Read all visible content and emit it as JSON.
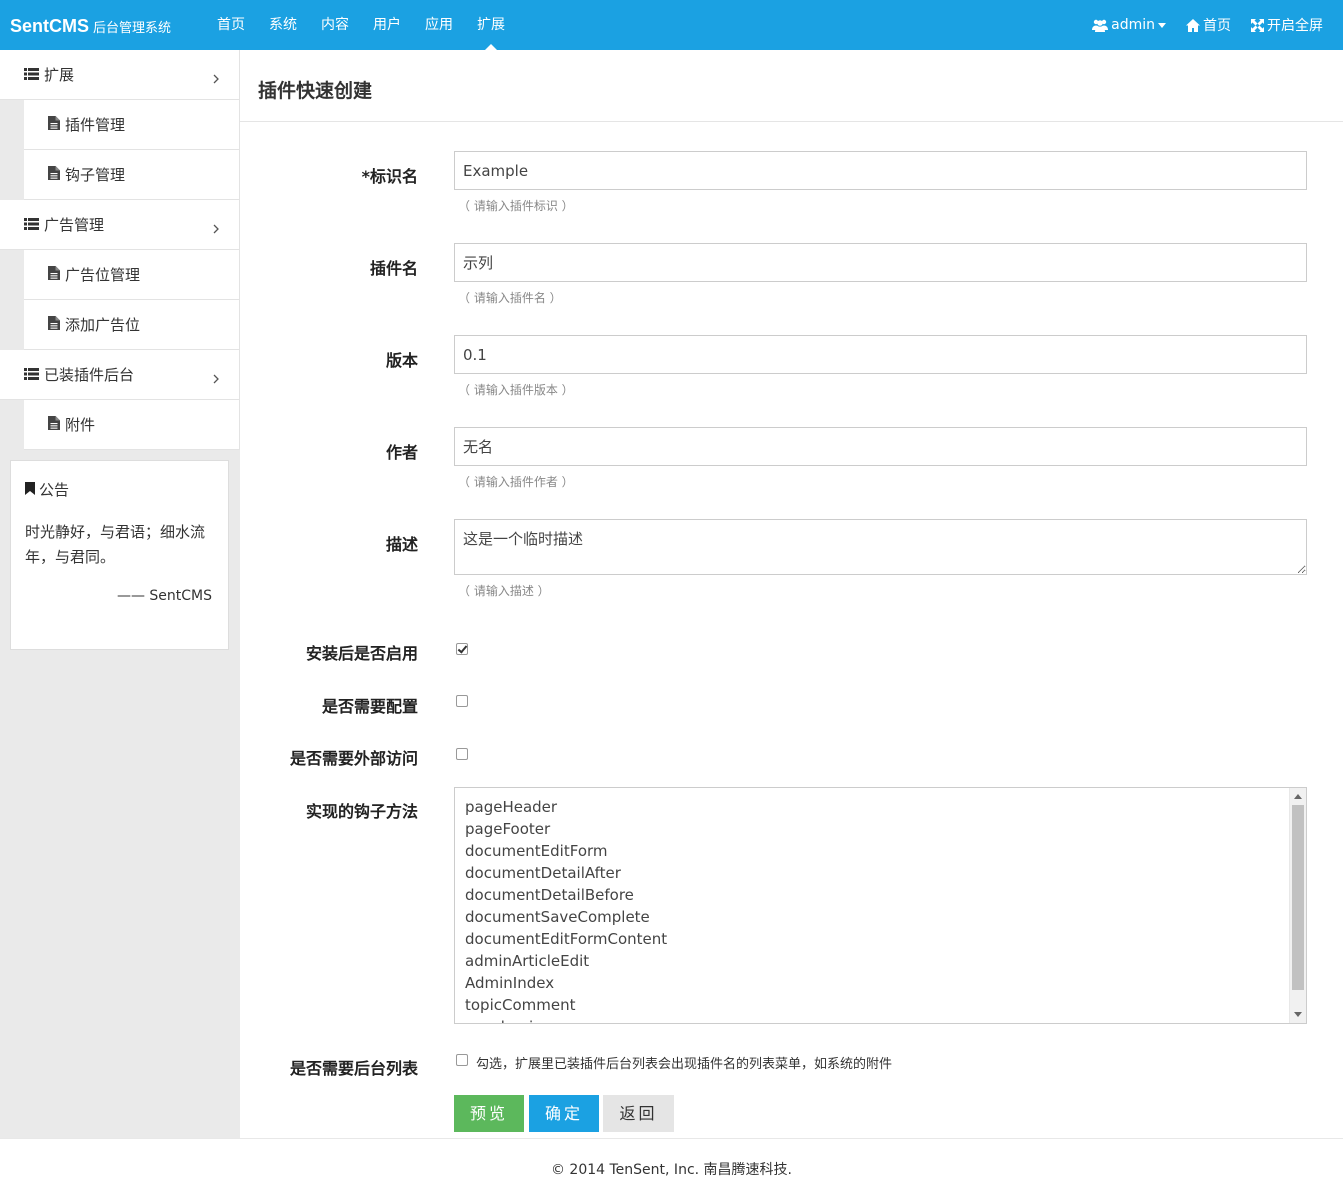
{
  "brand": {
    "name": "SentCMS",
    "subtitle": "后台管理系统"
  },
  "nav": {
    "items": [
      {
        "label": "首页"
      },
      {
        "label": "系统"
      },
      {
        "label": "内容"
      },
      {
        "label": "用户"
      },
      {
        "label": "应用"
      },
      {
        "label": "扩展",
        "active": true
      }
    ],
    "right": {
      "user": "admin",
      "home": "首页",
      "fullscreen": "开启全屏"
    }
  },
  "sidebar": {
    "groups": [
      {
        "label": "扩展",
        "children": [
          "插件管理",
          "钩子管理"
        ]
      },
      {
        "label": "广告管理",
        "children": [
          "广告位管理",
          "添加广告位"
        ]
      },
      {
        "label": "已装插件后台",
        "children": [
          "附件"
        ]
      }
    ],
    "notice": {
      "title": "公告",
      "text": "时光静好，与君语；细水流年，与君同。",
      "signature": "—— SentCMS"
    }
  },
  "page": {
    "title": "插件快速创建"
  },
  "form": {
    "name": {
      "label": "*标识名",
      "value": "Example",
      "help": "（ 请输入插件标识 ）"
    },
    "title": {
      "label": "插件名",
      "value": "示列",
      "help": "（ 请输入插件名 ）"
    },
    "version": {
      "label": "版本",
      "value": "0.1",
      "help": "（ 请输入插件版本 ）"
    },
    "author": {
      "label": "作者",
      "value": "无名",
      "help": "（ 请输入插件作者 ）"
    },
    "description": {
      "label": "描述",
      "value": "这是一个临时描述",
      "help": "（ 请输入描述 ）"
    },
    "enable_after_install": {
      "label": "安装后是否启用",
      "checked": true
    },
    "need_config": {
      "label": "是否需要配置",
      "checked": false
    },
    "external_access": {
      "label": "是否需要外部访问",
      "checked": false
    },
    "hooks": {
      "label": "实现的钩子方法",
      "options": [
        "pageHeader",
        "pageFooter",
        "documentEditForm",
        "documentDetailAfter",
        "documentDetailBefore",
        "documentSaveComplete",
        "documentEditFormContent",
        "adminArticleEdit",
        "AdminIndex",
        "topicComment",
        "app_begin"
      ]
    },
    "admin_list": {
      "label": "是否需要后台列表",
      "checked": false,
      "help": "勾选，扩展里已装插件后台列表会出现插件名的列表菜单，如系统的附件"
    },
    "buttons": {
      "preview": "预览",
      "submit": "确定",
      "back": "返回"
    }
  },
  "footer": {
    "text": "© 2014 TenSent, Inc. 南昌腾速科技."
  },
  "colors": {
    "primary": "#1ba1e2",
    "success": "#5cb85c",
    "sidebar_bg": "#eaeaea"
  }
}
